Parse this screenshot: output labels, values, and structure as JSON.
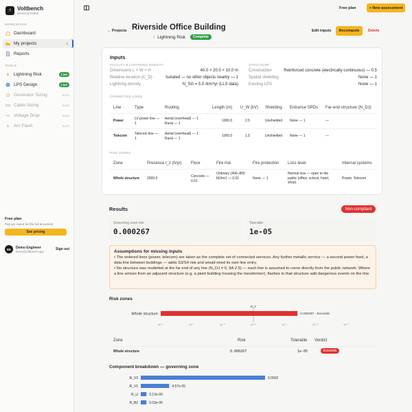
{
  "app": {
    "name": "Voltbench",
    "tagline": "electrical toolkit"
  },
  "sidebar": {
    "workspace_label": "WORKSPACE",
    "tools_label": "TOOLS",
    "workspace_items": [
      {
        "label": "Dashboard"
      },
      {
        "label": "My projects",
        "count": "2"
      },
      {
        "label": "Reports"
      }
    ],
    "tools": [
      {
        "label": "Lightning Risk",
        "badge": "Live"
      },
      {
        "label": "LPS Design",
        "badge": "Live"
      },
      {
        "label": "Generator Sizing",
        "badge": "Soon"
      },
      {
        "label": "Cable Sizing",
        "badge": "Soon"
      },
      {
        "label": "Voltage Drop",
        "badge": "Soon"
      },
      {
        "label": "Arc Flash",
        "badge": "Soon"
      }
    ],
    "plan": {
      "title": "Free plan",
      "sub": "Pay per report for the full document",
      "cta": "See pricing"
    },
    "user": {
      "initials": "DE",
      "name": "Demo Engineer",
      "email": "demo@voltbench.app",
      "signout": "Sign out"
    }
  },
  "topbar": {
    "free_plan": "Free plan",
    "new_assessment": "+ New assessment"
  },
  "header": {
    "breadcrumb": "← Projects",
    "title": "Riverside Office Building",
    "subtitle": "Lightning Risk",
    "status": "Complete",
    "edit": "Edit inputs",
    "recompute": "Recompute",
    "delete": "Delete"
  },
  "inputs": {
    "heading": "Inputs",
    "facility_label": "FACILITY & LIGHTNING DENSITY",
    "structure_label": "STRUCTURE",
    "facility": [
      {
        "k": "Dimensions L × W × H",
        "v": "40.0 × 20.0 × 10.0 m"
      },
      {
        "k": "Relative location (C_D)",
        "v": "Isolated — no other objects nearby — 1"
      },
      {
        "k": "Lightning density",
        "v": "N_SG = 5.0 /km²/yr (LLS data)"
      }
    ],
    "structure": [
      {
        "k": "Construction",
        "v": "Reinforced concrete (electrically continuous) — 0.5"
      },
      {
        "k": "Spatial shielding",
        "v": "None — 1"
      },
      {
        "k": "Existing LPS",
        "v": "None — 1"
      }
    ],
    "lines_label": "CONNECTED LINES",
    "lines_headers": [
      "Line",
      "Type",
      "Routing",
      "Length (m)",
      "U_W (kV)",
      "Shielding",
      "Entrance SPDs",
      "Far-end structure (N_DJ)"
    ],
    "lines": [
      {
        "line": "Power",
        "type": "LV power line — 1",
        "routing": "Aerial (overhead) — 1 · Rural — 1",
        "length": "1000.0",
        "uw": "2.5",
        "shielding": "Unshielded",
        "spd": "None — 1",
        "far": "—"
      },
      {
        "line": "Telecom",
        "type": "Telecom line — 1",
        "routing": "Aerial (overhead) — 1 · Rural — 1",
        "length": "1000.0",
        "uw": "1.5",
        "shielding": "Unshielded",
        "spd": "None — 1",
        "far": "—"
      }
    ],
    "zones_label": "RISK ZONES",
    "zones_headers": [
      "Zone",
      "Presence t_z (h/yr)",
      "Floor",
      "Fire risk",
      "Fire protection",
      "Loss level",
      "Internal systems"
    ],
    "zones": [
      {
        "zone": "Whole structure",
        "presence": "2000.0",
        "floor": "Concrete — 0.01",
        "fire": "Ordinary (400–800 MJ/m²) — 0.01",
        "protection": "None — 1",
        "loss": "Normal loss — open to the public (office, school, hotel, shop)",
        "internal": "Power, Telecom"
      }
    ]
  },
  "results": {
    "heading": "Results",
    "verdict": "Non-compliant",
    "governing_label": "Governing zone risk",
    "governing_value": "0.000267",
    "tolerable_label": "Tolerable",
    "tolerable_value": "1e-05",
    "assumptions": {
      "title": "Assumptions for missing inputs",
      "items": [
        "•  The entered lines (power, telecom) are taken as the complete set of connected services. Any further metallic service — a second power feed, a data line between buildings — adds S3/S4 risk and would need its own line entry.",
        "•  No structure was modelled at the far end of any line (N_DJ = 0, §A.2.5) — each line is assumed to come directly from the public network. Where a line arrives from an adjacent structure (e.g. a plant building housing the transformer), flashes to that structure add dangerous events on the line."
      ]
    },
    "risk_zones_heading": "Risk zones",
    "risk_table_headers": [
      "Zone",
      "Risk",
      "Tolerable",
      "Verdict"
    ],
    "risk_table": [
      {
        "zone": "Whole structure",
        "risk": "0.000267",
        "tolerable": "1e-05",
        "verdict": "Exceeds"
      }
    ],
    "breakdown_heading": "Component breakdown — governing zone"
  },
  "chart_data": [
    {
      "type": "bar",
      "orientation": "horizontal",
      "scale": "log",
      "categories": [
        "Whole structure"
      ],
      "values": [
        0.000267
      ],
      "value_labels": [
        "0.000267 · Exceeds"
      ],
      "threshold": 1e-05,
      "threshold_label": "R_T",
      "xticks": [
        "10⁻⁸",
        "10⁻⁷",
        "10⁻⁶",
        "10⁻⁵",
        "10⁻⁴",
        "10⁻³",
        "10⁻²"
      ],
      "xlim_exp": [
        -8,
        -2
      ],
      "bar_color": "#e03131"
    },
    {
      "type": "bar",
      "orientation": "horizontal",
      "categories": [
        "R_V2",
        "R_V1",
        "R_U",
        "R_B2"
      ],
      "values": [
        0.0002,
        4.57e-05,
        9.13e-06,
        9.03e-06
      ],
      "value_labels": [
        "0.0002",
        "4.57e-05",
        "9.13e-06",
        "9.03e-06"
      ],
      "bar_color": "#4a7fd4"
    }
  ]
}
